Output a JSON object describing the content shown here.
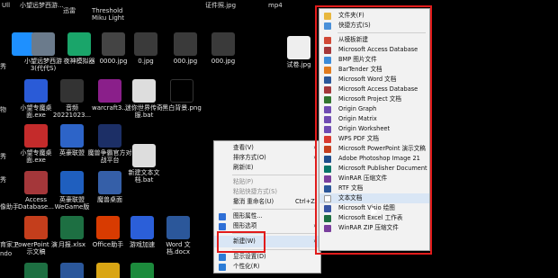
{
  "top_labels": [
    "Ull",
    "小望远梦西游...",
    "迅雷",
    "Threshold Miku Light",
    "证件照.jpg",
    "mp4"
  ],
  "desktop_icons": [
    {
      "label": "",
      "color": "#1e90ff"
    },
    {
      "label": "小望远梦西游3(代代S)",
      "color": "#6b7b8c"
    },
    {
      "label": "夜神模拟器",
      "color": "#1aa56a"
    },
    {
      "label": "0000.jpg",
      "color": "#444"
    },
    {
      "label": "0.jpg",
      "color": "#3a3a3a"
    },
    {
      "label": "000.jpg",
      "color": "#3a3a3a"
    },
    {
      "label": "000.jpg",
      "color": "#3a3a3a"
    },
    {
      "label": "试卷.jpg",
      "color": "#eeeeee"
    },
    {
      "label": "小望专魔桌面.exe",
      "color": "#2a5bd7"
    },
    {
      "label": "音频 20221023...",
      "color": "#333"
    },
    {
      "label": "warcraft3...",
      "color": "#8a1f8a"
    },
    {
      "label": "迷你世界传奇服.bat",
      "color": "#dddddd"
    },
    {
      "label": "黑白背景.png",
      "color": "#000000"
    },
    {
      "label": "小望专魔桌面.exe",
      "color": "#c42b2b"
    },
    {
      "label": "英豪联盟",
      "color": "#2d64c8"
    },
    {
      "label": "魔兽争霸官方对战平台",
      "color": "#1c2f66"
    },
    {
      "label": "新建文本文档.bat",
      "color": "#dddddd"
    },
    {
      "label": "Access Database...",
      "color": "#a4373a"
    },
    {
      "label": "英豪联盟 WeGame版",
      "color": "#1f5fbf"
    },
    {
      "label": "魔兽桌面",
      "color": "#355fa8"
    },
    {
      "label": "PowerPoint 演示文稿",
      "color": "#c43e1c"
    },
    {
      "label": "月报.xlsx",
      "color": "#1d6f42"
    },
    {
      "label": "Office助手",
      "color": "#d83b01"
    },
    {
      "label": "游戏加速",
      "color": "#2b5fd9"
    },
    {
      "label": "Word 文档.docx",
      "color": "#2b579a"
    }
  ],
  "left_partial_labels": [
    "秀",
    "物",
    "秀",
    "秀",
    "像助手",
    "育家工",
    "ndo"
  ],
  "context_menu": {
    "items": [
      {
        "label": "查看(V)",
        "has_submenu": true
      },
      {
        "label": "排序方式(O)",
        "has_submenu": true
      },
      {
        "label": "刷新(E)"
      },
      {
        "label": "粘贴(P)",
        "disabled": true
      },
      {
        "label": "粘贴快捷方式(S)",
        "disabled": true
      },
      {
        "label": "撤消 重命名(U)",
        "shortcut": "Ctrl+Z"
      },
      {
        "label": "图形属性...",
        "icon_color": "#2f6fd6"
      },
      {
        "label": "图形选项",
        "icon_color": "#2f6fd6",
        "has_submenu": true
      },
      {
        "label": "新建(W)",
        "has_submenu": true
      },
      {
        "label": "显示设置(D)",
        "icon_color": "#2d7cd6"
      },
      {
        "label": "个性化(R)",
        "icon_color": "#2d7cd6"
      }
    ]
  },
  "new_submenu": {
    "items": [
      {
        "label": "文件夹(F)",
        "icon_color": "#e8b73d"
      },
      {
        "label": "快捷方式(S)",
        "icon_color": "#4a90d9"
      },
      {
        "label": "从模板新建",
        "icon_color": "#d14836"
      },
      {
        "label": "Microsoft Access Database",
        "icon_color": "#a4373a"
      },
      {
        "label": "BMP 图片文件",
        "icon_color": "#3b8bd9"
      },
      {
        "label": "BarTender 文档",
        "icon_color": "#e07b1f"
      },
      {
        "label": "Microsoft Word 文档",
        "icon_color": "#2b579a"
      },
      {
        "label": "Microsoft Access Database",
        "icon_color": "#a4373a"
      },
      {
        "label": "Microsoft Project 文档",
        "icon_color": "#31752f"
      },
      {
        "label": "Origin Graph",
        "icon_color": "#6f4bb2"
      },
      {
        "label": "Origin Matrix",
        "icon_color": "#6f4bb2"
      },
      {
        "label": "Origin Worksheet",
        "icon_color": "#6f4bb2"
      },
      {
        "label": "WPS PDF 文档",
        "icon_color": "#d93a2f"
      },
      {
        "label": "Microsoft PowerPoint 演示文稿",
        "icon_color": "#c43e1c"
      },
      {
        "label": "Adobe Photoshop Image 21",
        "icon_color": "#1e4e8c"
      },
      {
        "label": "Microsoft Publisher Document",
        "icon_color": "#077568"
      },
      {
        "label": "WinRAR 压缩文件",
        "icon_color": "#7a3f9d"
      },
      {
        "label": "RTF 文档",
        "icon_color": "#2b579a"
      },
      {
        "label": "文本文档",
        "icon_color": "#cfcfcf"
      },
      {
        "label": "Microsoft Visio 绘图",
        "icon_color": "#3955a3"
      },
      {
        "label": "Microsoft Excel 工作表",
        "icon_color": "#1d6f42"
      },
      {
        "label": "WinRAR ZIP 压缩文件",
        "icon_color": "#7a3f9d"
      }
    ]
  },
  "colors": {
    "highlight_box": "#e11b1b",
    "menu_bg": "#f2f2f2"
  }
}
